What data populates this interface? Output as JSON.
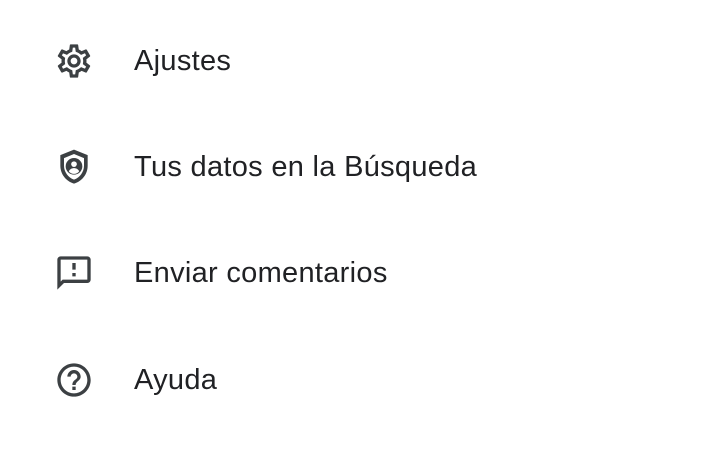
{
  "menu": {
    "items": [
      {
        "label": "Ajustes",
        "icon": "gear-icon"
      },
      {
        "label": "Tus datos en la Búsqueda",
        "icon": "shield-person-icon"
      },
      {
        "label": "Enviar comentarios",
        "icon": "feedback-icon"
      },
      {
        "label": "Ayuda",
        "icon": "help-circle-icon"
      }
    ]
  },
  "colors": {
    "text": "#202124",
    "icon": "#3c4043",
    "background": "#ffffff"
  }
}
